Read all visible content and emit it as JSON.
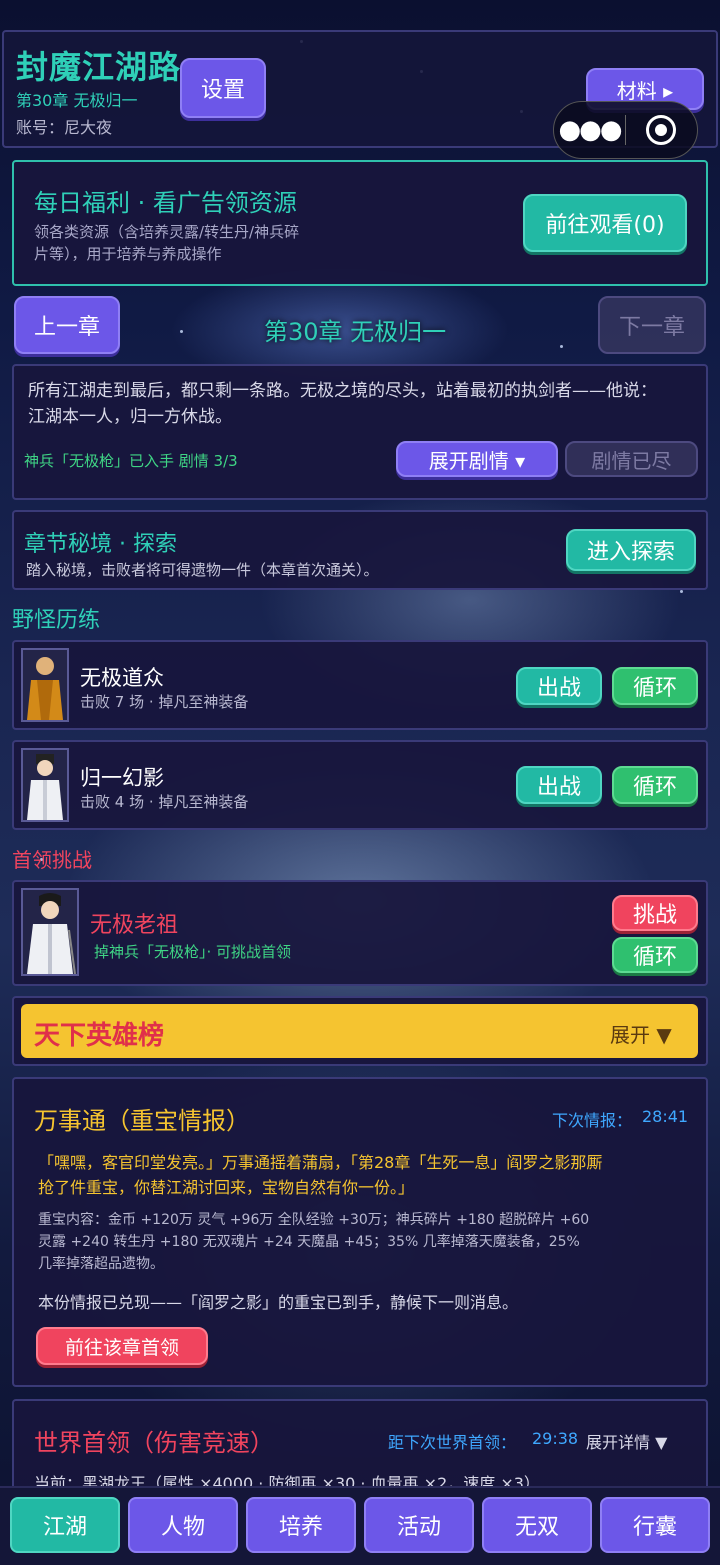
{
  "header": {
    "title": "封魔江湖路",
    "chapter": "第30章 无极归一",
    "account": "账号：尼大夜",
    "settings_label": "设置",
    "materials_label": "材料 ▸"
  },
  "daily": {
    "title": "每日福利 · 看广告领资源",
    "desc_line1": "领各类资源（含培养灵露/转生丹/神兵碎",
    "desc_line2": "片等），用于培养与养成操作",
    "button_label": "前往观看(0)"
  },
  "chapter_nav": {
    "prev_label": "上一章",
    "title": "第30章 无极归一",
    "next_label": "下一章"
  },
  "story": {
    "line1": "所有江湖走到最后，都只剩一条路。无极之境的尽头，站着最初的执剑者——他说：",
    "line2": "江湖本一人，归一方休战。",
    "status": "神兵「无极枪」已入手  剧情 3/3",
    "expand_label": "展开剧情 ▾",
    "ended_label": "剧情已尽"
  },
  "secret": {
    "title": "章节秘境 · 探索",
    "desc": "踏入秘境，击败者将可得遗物一件（本章首次通关）。",
    "button_label": "进入探索"
  },
  "wild": {
    "section_title": "野怪历练",
    "monsters": [
      {
        "name": "无极道众",
        "desc": "击败 7 场 · 掉凡至神装备",
        "fight_label": "出战",
        "loop_label": "循环"
      },
      {
        "name": "归一幻影",
        "desc": "击败 4 场 · 掉凡至神装备",
        "fight_label": "出战",
        "loop_label": "循环"
      }
    ]
  },
  "boss": {
    "section_title": "首领挑战",
    "name": "无极老祖",
    "desc": "掉神兵「无极枪」· 可挑战首领",
    "challenge_label": "挑战",
    "loop_label": "循环"
  },
  "ranking": {
    "title": "天下英雄榜",
    "expand_label": "展开 ▼"
  },
  "intel": {
    "title": "万事通（重宝情报）",
    "timer_label": "下次情报：",
    "timer_value": "28:41",
    "quote_line1": "「嘿嘿，客官印堂发亮。」万事通摇着蒲扇，「第28章「生死一息」阎罗之影那厮",
    "quote_line2": "抢了件重宝，你替江湖讨回来，宝物自然有你一份。」",
    "content_line1": "重宝内容：金币 +120万  灵气 +96万  全队经验 +30万；神兵碎片 +180  超脱碎片 +60",
    "content_line2": "  灵露 +240  转生丹 +180  无双魂片 +24  天魔晶 +45；35% 几率掉落天魔装备，25%",
    "content_line3": "几率掉落超品遗物。",
    "note": "本份情报已兑现——「阎罗之影」的重宝已到手，静候下一则消息。",
    "button_label": "前往该章首领"
  },
  "world_boss": {
    "title": "世界首领（伤害竞速）",
    "timer_label": "距下次世界首领：",
    "timer_value": "29:38",
    "expand_label": "展开详情 ▼",
    "current": "当前：黑湖龙王（属性 ×4000 · 防御再 ×30 · 血量再 ×2，速度 ×3）"
  },
  "bottom_nav": [
    "江湖",
    "人物",
    "培养",
    "活动",
    "无双",
    "行囊"
  ],
  "colors": {
    "accent_teal": "#22b9a4",
    "accent_purple": "#6c57e8",
    "danger_red": "#f0445e",
    "gold": "#f5c430"
  }
}
